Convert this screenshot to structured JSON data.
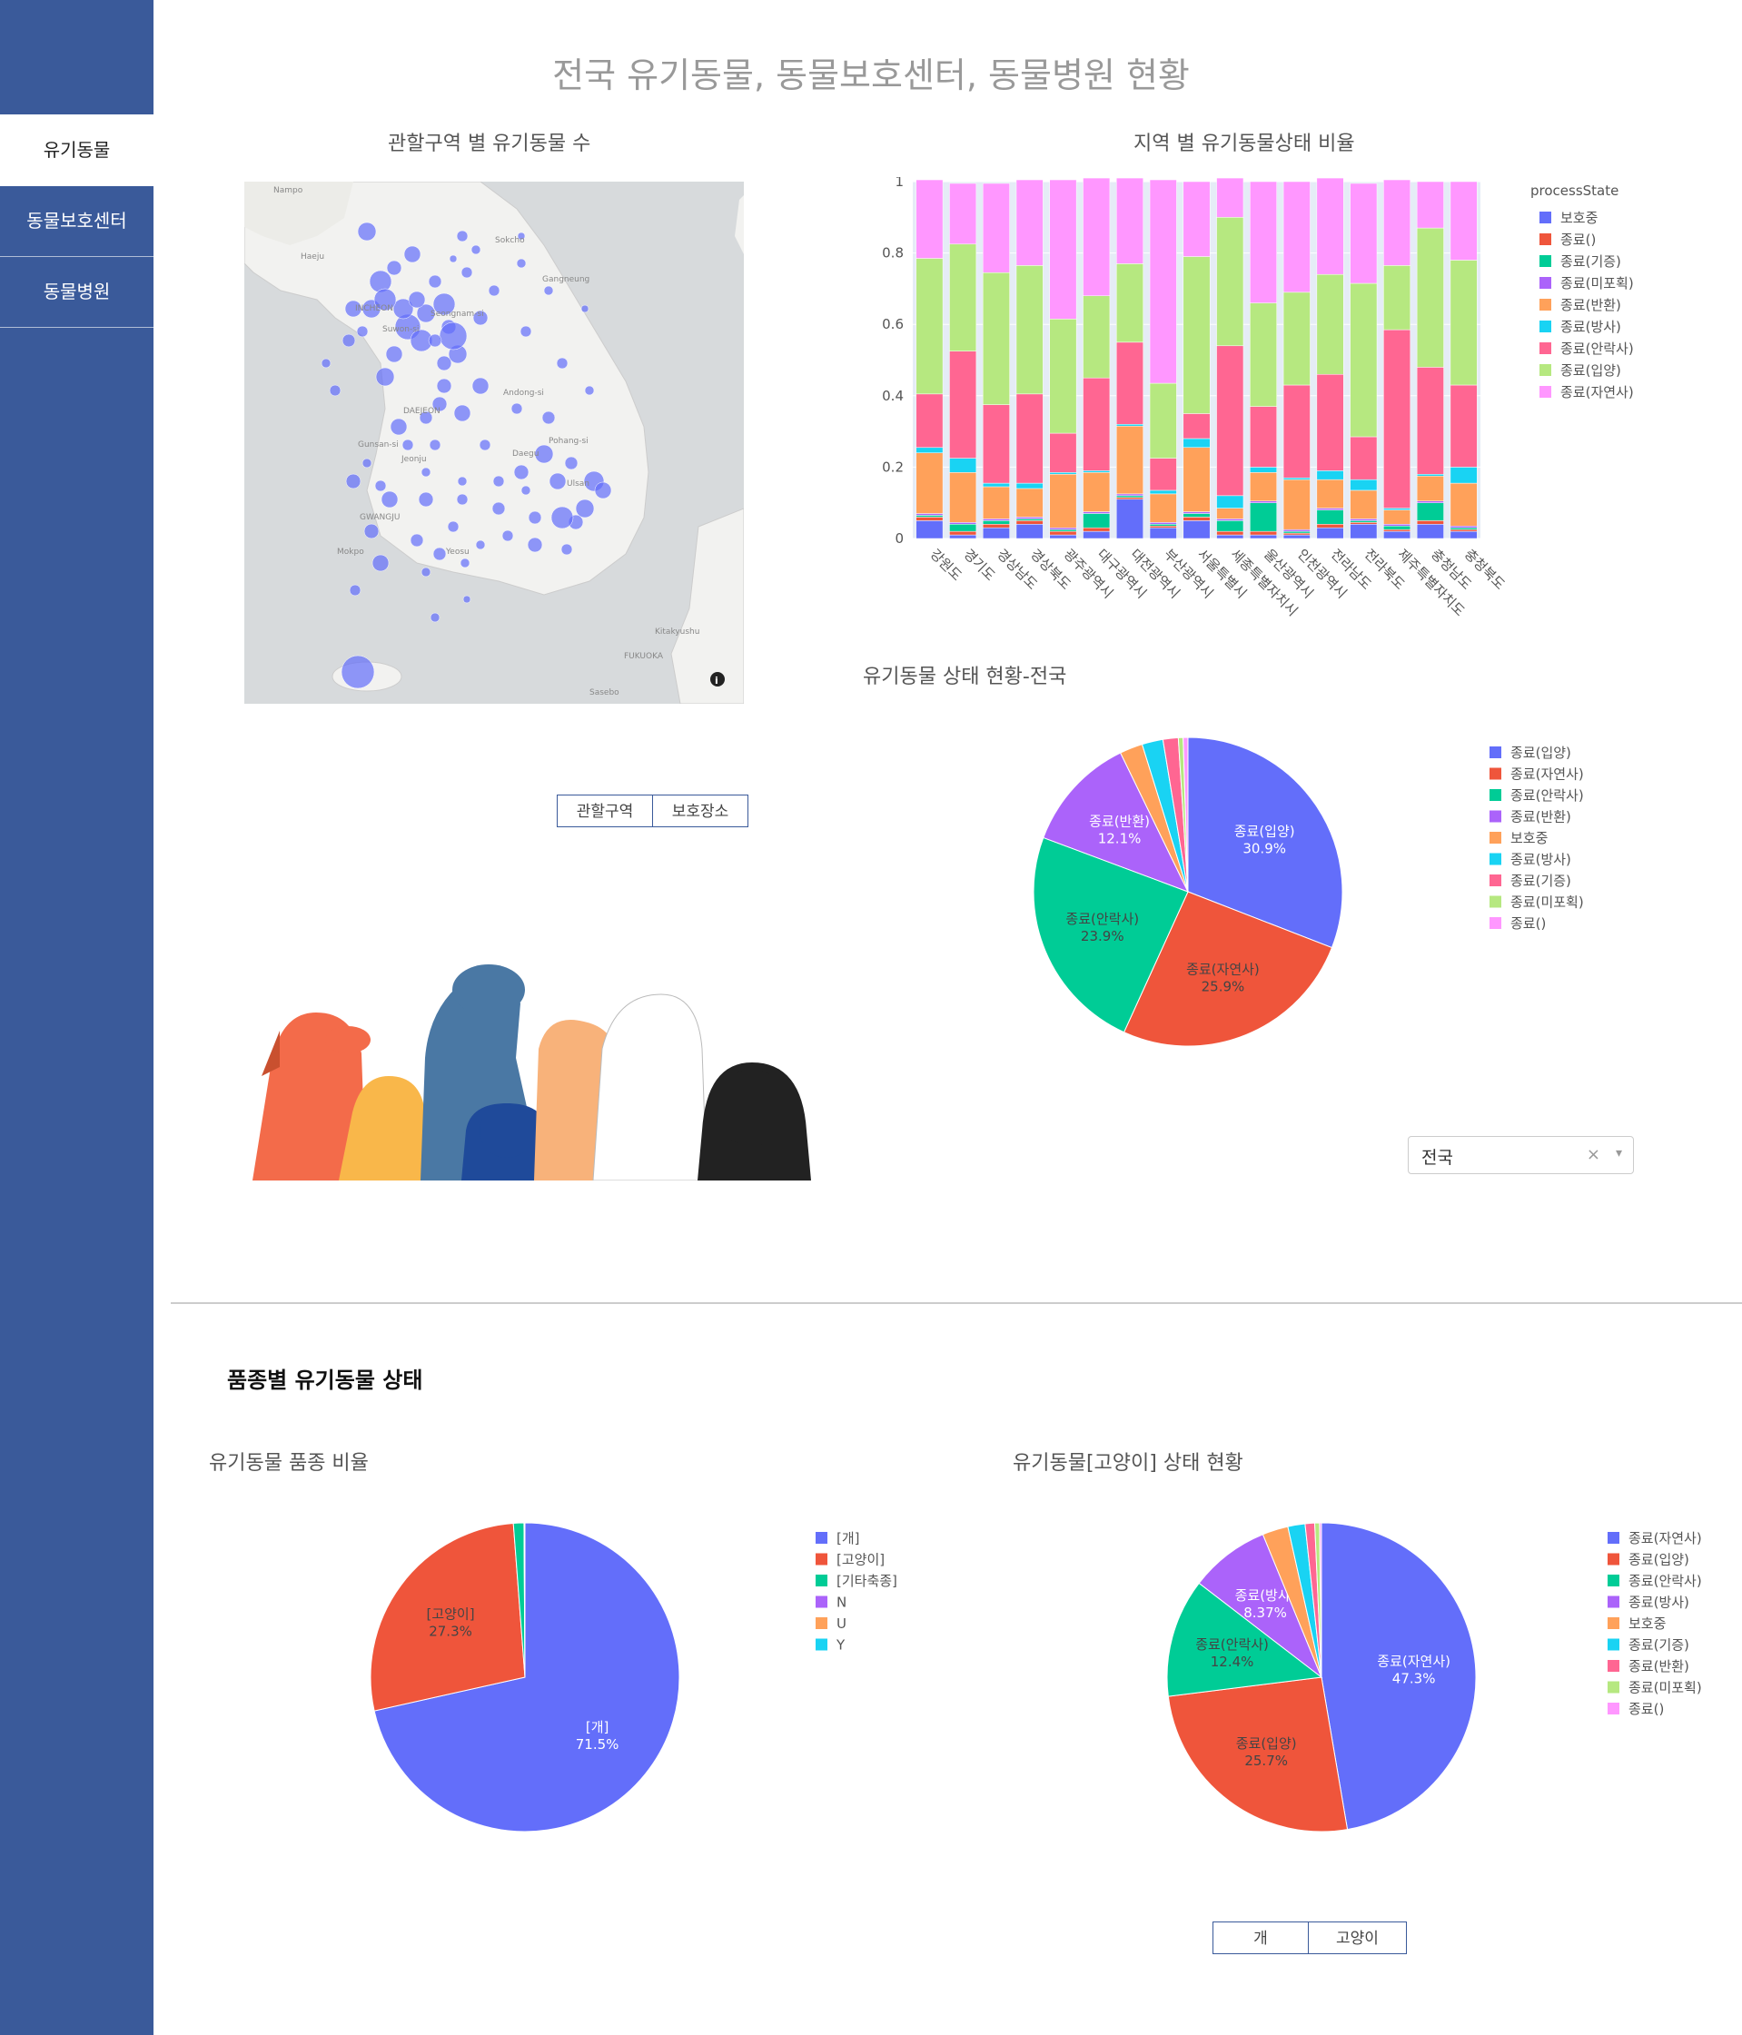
{
  "title": "전국 유기동물, 동물보호센터, 동물병원 현황",
  "sidebar": {
    "items": [
      {
        "label": "유기동물",
        "active": true
      },
      {
        "label": "동물보호센터",
        "active": false
      },
      {
        "label": "동물병원",
        "active": false
      }
    ]
  },
  "map": {
    "title": "관할구역 별 유기동물 수",
    "labels": [
      {
        "text": "Nampo"
      },
      {
        "text": "Haeju"
      },
      {
        "text": "Sokcho"
      },
      {
        "text": "Gangneung"
      },
      {
        "text": "INCHEON"
      },
      {
        "text": "Seongnam-si"
      },
      {
        "text": "Suwon-si"
      },
      {
        "text": "Andong-si"
      },
      {
        "text": "DAEJEON"
      },
      {
        "text": "Gunsan-si"
      },
      {
        "text": "Jeonju"
      },
      {
        "text": "Pohang-si"
      },
      {
        "text": "Ulsan"
      },
      {
        "text": "Daegu"
      },
      {
        "text": "GWANGJU"
      },
      {
        "text": "Mokpo"
      },
      {
        "text": "Yeosu"
      },
      {
        "text": "Kitakyushu"
      },
      {
        "text": "FUKUOKA"
      },
      {
        "text": "Sasebo"
      }
    ],
    "buttons": [
      "관할구역",
      "보호장소"
    ]
  },
  "bar_chart_title": "지역 별 유기동물상태 비율",
  "pie1_title": "유기동물 상태 현황-전국",
  "dropdown": {
    "value": "전국",
    "clear": "×",
    "chevron": "▾"
  },
  "section_title": "품종별 유기동물 상태",
  "pie2_title": "유기동물 품종 비율",
  "pie3_title": "유기동물[고양이] 상태 현황",
  "breed_buttons": [
    "개",
    "고양이"
  ],
  "colors": {
    "sidebar": "#3a5a9a",
    "accent": "#3a5a9a"
  },
  "chart_data": [
    {
      "type": "bar",
      "stacked": true,
      "title": "지역 별 유기동물상태 비율",
      "legend_title": "processState",
      "categories": [
        "강원도",
        "경기도",
        "경상남도",
        "경상북도",
        "광주광역시",
        "대구광역시",
        "대전광역시",
        "부산광역시",
        "서울특별시",
        "세종특별자치시",
        "울산광역시",
        "인천광역시",
        "전라남도",
        "전라북도",
        "제주특별자치도",
        "충청남도",
        "충청북도"
      ],
      "ylim": [
        0,
        1
      ],
      "yticks": [
        0,
        0.2,
        0.4,
        0.6,
        0.8,
        1
      ],
      "series": [
        {
          "name": "보호중",
          "color": "#636efa",
          "values": [
            0.05,
            0.01,
            0.03,
            0.04,
            0.01,
            0.02,
            0.11,
            0.03,
            0.05,
            0.01,
            0.01,
            0.01,
            0.03,
            0.04,
            0.02,
            0.04,
            0.02
          ]
        },
        {
          "name": "종료()",
          "color": "#ef553b",
          "values": [
            0.01,
            0.01,
            0.01,
            0.01,
            0.01,
            0.01,
            0.005,
            0.005,
            0.01,
            0.01,
            0.01,
            0.005,
            0.01,
            0.005,
            0.005,
            0.01,
            0.005
          ]
        },
        {
          "name": "종료(기증)",
          "color": "#00cc96",
          "values": [
            0.005,
            0.02,
            0.01,
            0.005,
            0.005,
            0.04,
            0.005,
            0.005,
            0.01,
            0.03,
            0.08,
            0.005,
            0.04,
            0.005,
            0.01,
            0.05,
            0.005
          ]
        },
        {
          "name": "종료(미포획)",
          "color": "#ab63fa",
          "values": [
            0.005,
            0.005,
            0.005,
            0.005,
            0.005,
            0.005,
            0.005,
            0.005,
            0.005,
            0.005,
            0.005,
            0.005,
            0.005,
            0.005,
            0.005,
            0.005,
            0.005
          ]
        },
        {
          "name": "종료(반환)",
          "color": "#ffa15a",
          "values": [
            0.17,
            0.14,
            0.09,
            0.08,
            0.15,
            0.11,
            0.19,
            0.08,
            0.18,
            0.03,
            0.08,
            0.14,
            0.08,
            0.08,
            0.04,
            0.07,
            0.12
          ]
        },
        {
          "name": "종료(방사)",
          "color": "#19d3f3",
          "values": [
            0.015,
            0.04,
            0.01,
            0.015,
            0.005,
            0.005,
            0.005,
            0.01,
            0.025,
            0.035,
            0.015,
            0.005,
            0.025,
            0.03,
            0.005,
            0.005,
            0.045
          ]
        },
        {
          "name": "종료(안락사)",
          "color": "#ff6692",
          "values": [
            0.15,
            0.3,
            0.22,
            0.25,
            0.11,
            0.26,
            0.23,
            0.09,
            0.07,
            0.42,
            0.17,
            0.26,
            0.27,
            0.12,
            0.5,
            0.3,
            0.23
          ]
        },
        {
          "name": "종료(입양)",
          "color": "#b6e880",
          "values": [
            0.38,
            0.3,
            0.37,
            0.36,
            0.32,
            0.23,
            0.22,
            0.21,
            0.44,
            0.36,
            0.29,
            0.26,
            0.28,
            0.43,
            0.18,
            0.39,
            0.35
          ]
        },
        {
          "name": "종료(자연사)",
          "color": "#ff97ff",
          "values": [
            0.22,
            0.17,
            0.25,
            0.24,
            0.39,
            0.33,
            0.24,
            0.57,
            0.21,
            0.11,
            0.34,
            0.31,
            0.27,
            0.28,
            0.24,
            0.13,
            0.22
          ]
        }
      ]
    },
    {
      "type": "pie",
      "title": "유기동물 상태 현황-전국",
      "labels": [
        "종료(입양)",
        "종료(자연사)",
        "종료(안락사)",
        "종료(반환)",
        "보호중",
        "종료(방사)",
        "종료(기증)",
        "종료(미포획)",
        "종료()"
      ],
      "values": [
        30.9,
        25.9,
        23.9,
        12.1,
        2.4,
        2.2,
        1.6,
        0.5,
        0.5
      ],
      "colors": [
        "#636efa",
        "#ef553b",
        "#00cc96",
        "#ab63fa",
        "#ffa15a",
        "#19d3f3",
        "#ff6692",
        "#b6e880",
        "#ff97ff"
      ],
      "text_labels": [
        "종료(입양)\n30.9%",
        "종료(자연사)\n25.9%",
        "종료(안락사)\n23.9%",
        "종료(반환)\n12.1%",
        "",
        "",
        "",
        "",
        ""
      ]
    },
    {
      "type": "pie",
      "title": "유기동물 품종 비율",
      "labels": [
        "[개]",
        "[고양이]",
        "[기타축종]",
        "N",
        "U",
        "Y"
      ],
      "values": [
        71.5,
        27.3,
        1.1,
        0.05,
        0.03,
        0.02
      ],
      "colors": [
        "#636efa",
        "#ef553b",
        "#00cc96",
        "#ab63fa",
        "#ffa15a",
        "#19d3f3"
      ],
      "text_labels": [
        "[개]\n71.5%",
        "[고양이]\n27.3%",
        "",
        "",
        "",
        ""
      ]
    },
    {
      "type": "pie",
      "title": "유기동물[고양이] 상태 현황",
      "labels": [
        "종료(자연사)",
        "종료(입양)",
        "종료(안락사)",
        "종료(방사)",
        "보호중",
        "종료(기증)",
        "종료(반환)",
        "종료(미포획)",
        "종료()"
      ],
      "values": [
        47.3,
        25.7,
        12.4,
        8.37,
        2.7,
        1.8,
        1.0,
        0.5,
        0.2
      ],
      "colors": [
        "#636efa",
        "#ef553b",
        "#00cc96",
        "#ab63fa",
        "#ffa15a",
        "#19d3f3",
        "#ff6692",
        "#b6e880",
        "#ff97ff"
      ],
      "text_labels": [
        "종료(자연사)\n47.3%",
        "종료(입양)\n25.7%",
        "종료(안락사)\n12.4%",
        "종료(방사)\n8.37%",
        "",
        "",
        "",
        "",
        ""
      ]
    }
  ]
}
